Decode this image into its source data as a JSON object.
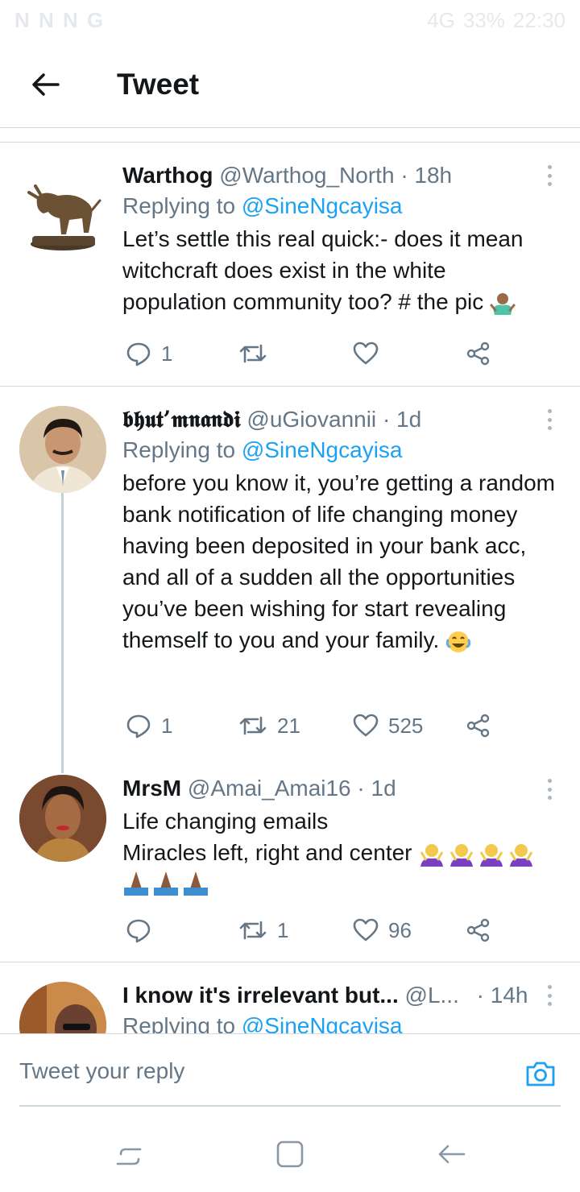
{
  "status_bar": {
    "left_icons": "N N N G",
    "battery": "33%",
    "time": "22:30",
    "signal": "4G"
  },
  "header": {
    "title": "Tweet",
    "back_icon": "arrow-left-icon"
  },
  "tweets": [
    {
      "name": "Warthog",
      "handle": "@Warthog_North",
      "time": "· 18h",
      "replying_prefix": "Replying to",
      "replying_to": "@SineNgcayisa",
      "text": "Let’s settle this real quick:- does it mean witchcraft does exist in the white population community too? # the pic",
      "reply_count": "1",
      "retweet_count": "",
      "like_count": ""
    },
    {
      "name": "𝖇𝖍𝖚𝖙’𝖒𝖓𝖆𝖓𝖉𝖎",
      "handle": "@uGiovannii",
      "time": "· 1d",
      "replying_prefix": "Replying to",
      "replying_to": "@SineNgcayisa",
      "text": "before you know it, you’re getting a random bank notification of life changing money having been deposited in your bank acc, and all of a sudden all the opportunities you’ve been wishing for start revealing themself to you and your family.",
      "reply_count": "1",
      "retweet_count": "21",
      "like_count": "525"
    },
    {
      "name": "MrsM",
      "handle": "@Amai_Amai16",
      "time": "· 1d",
      "text_line1": "Life changing emails",
      "text_line2": "Miracles left, right and center",
      "reply_count": "",
      "retweet_count": "1",
      "like_count": "96"
    },
    {
      "name": "I know it's irrelevant but...",
      "handle": "@L...",
      "time": "· 14h",
      "replying_prefix": "Replying to",
      "replying_to": "@SineNgcayisa"
    }
  ],
  "reply_bar": {
    "placeholder": "Tweet your reply"
  },
  "colors": {
    "accent": "#1da1f2",
    "text": "#14171a",
    "muted": "#657786",
    "divider": "#d4d9de"
  }
}
